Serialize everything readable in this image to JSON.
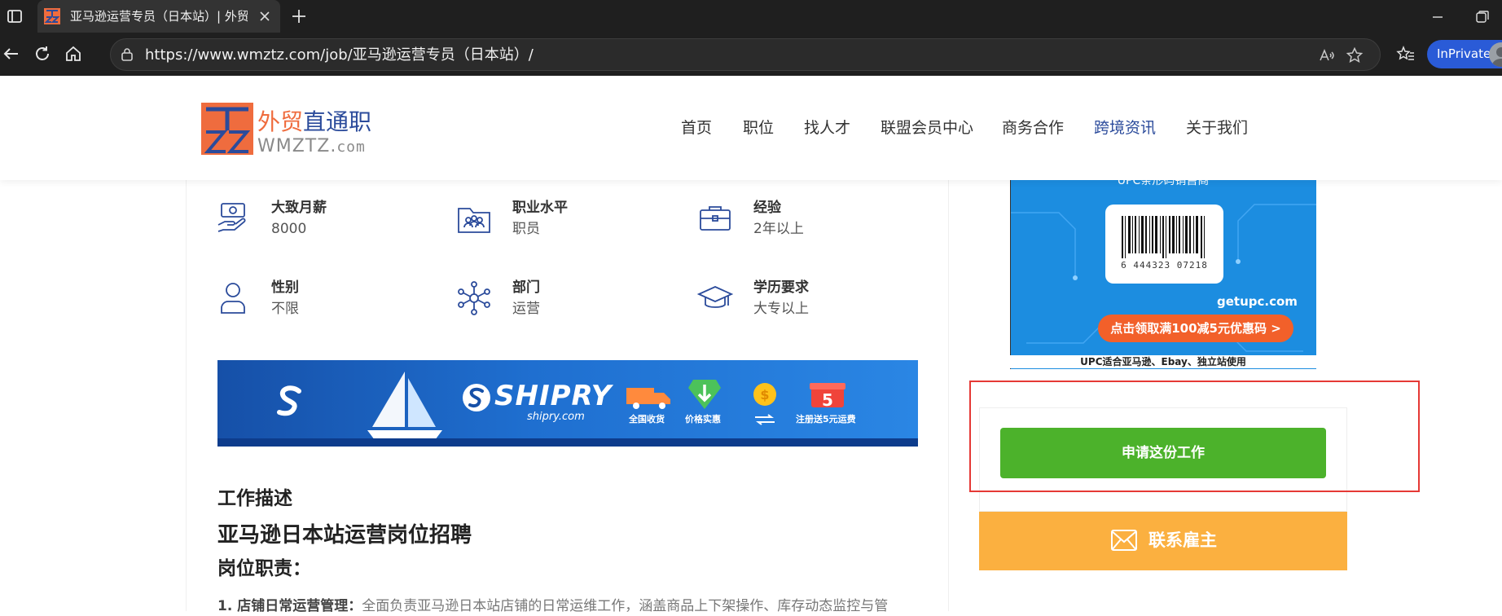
{
  "browser": {
    "tab_title": "亚马逊运营专员（日本站）| 外贸直通职",
    "url": "https://www.wmztz.com/job/亚马逊运营专员（日本站）/",
    "inprivate_label": "InPrivate"
  },
  "site": {
    "logo_cn_part1": "外贸",
    "logo_cn_part2": "直通职",
    "logo_en": "WMZTZ.",
    "logo_en_suffix": "com",
    "nav": [
      "首页",
      "职位",
      "找人才",
      "联盟会员中心",
      "商务合作",
      "跨境资讯",
      "关于我们"
    ],
    "active_nav": "跨境资讯",
    "colors": {
      "brand_orange": "#ef6c3e",
      "brand_blue": "#2b4b9b",
      "apply_green": "#4cb22b",
      "contact_orange": "#fbb040",
      "highlight_red": "#e53935"
    }
  },
  "job_info": {
    "salary_label": "大致月薪",
    "salary_value": "8000",
    "level_label": "职业水平",
    "level_value": "职员",
    "experience_label": "经验",
    "experience_value": "2年以上",
    "gender_label": "性别",
    "gender_value": "不限",
    "department_label": "部门",
    "department_value": "运营",
    "education_label": "学历要求",
    "education_value": "大专以上"
  },
  "banner": {
    "brand": "SHIPRY",
    "site": "shipry.com",
    "captions": [
      "全国收货",
      "价格实惠",
      "注册送5元运费"
    ],
    "gift_number": "5"
  },
  "description": {
    "heading": "工作描述",
    "title": "亚马逊日本站运营岗位招聘",
    "duty_heading": "岗位职责：",
    "first_item_label": "1. 店铺日常运营管理：",
    "first_item_text": "全面负责亚马逊日本站店铺的日常运维工作，涵盖商品上下架操作、库存动态监控与管"
  },
  "sidebar": {
    "upc_top_text": "UPC条形码销售商",
    "barcode_number": "6 444323 07218",
    "upc_site": "getupc.com",
    "upc_button": "点击领取满100减5元优惠码 >",
    "upc_caption": "UPC适合亚马逊、Ebay、独立站使用",
    "apply_label": "申请这份工作",
    "contact_label": "联系雇主"
  }
}
